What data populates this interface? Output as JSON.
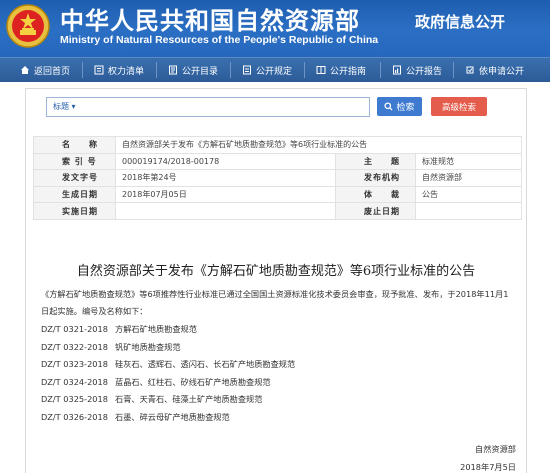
{
  "header": {
    "title": "中华人民共和国自然资源部",
    "subtitle": "Ministry of Natural Resources of the People's Republic of China",
    "section": "政府信息公开"
  },
  "nav": {
    "items": [
      {
        "label": "返回首页",
        "icon": "home-icon"
      },
      {
        "label": "权力清单",
        "icon": "list-icon"
      },
      {
        "label": "公开目录",
        "icon": "catalog-icon"
      },
      {
        "label": "公开规定",
        "icon": "rules-icon"
      },
      {
        "label": "公开指南",
        "icon": "guide-icon"
      },
      {
        "label": "公开报告",
        "icon": "report-icon"
      },
      {
        "label": "依申请公开",
        "icon": "apply-icon"
      }
    ]
  },
  "search": {
    "field_select": "标题 ▾",
    "search_label": "检索",
    "advanced_label": "高级检索"
  },
  "meta": {
    "name_label": "名　　称",
    "name_value": "自然资源部关于发布《方解石矿地质勘查规范》等6项行业标准的公告",
    "index_label": "索  引  号",
    "index_value": "000019174/2018-00178",
    "theme_label": "主　　题",
    "theme_value": "标准规范",
    "doc_no_label": "发文字号",
    "doc_no_value": "2018年第24号",
    "issuer_label": "发布机构",
    "issuer_value": "自然资源部",
    "created_label": "生成日期",
    "created_value": "2018年07月05日",
    "genre_label": "体　　裁",
    "genre_value": "公告",
    "effective_label": "实施日期",
    "effective_value": "",
    "abolish_label": "废止日期",
    "abolish_value": ""
  },
  "article": {
    "title": "自然资源部关于发布《方解石矿地质勘查规范》等6项行业标准的公告",
    "intro": "《方解石矿地质勘查规范》等6项推荐性行业标准已通过全国国土资源标准化技术委员会审查，现予批准、发布，于2018年11月1日起实施。编号及名称如下：",
    "standards": [
      {
        "code": "DZ/T 0321-2018",
        "name": "方解石矿地质勘查规范"
      },
      {
        "code": "DZ/T 0322-2018",
        "name": "钒矿地质勘查规范"
      },
      {
        "code": "DZ/T 0323-2018",
        "name": "硅灰石、透辉石、透闪石、长石矿产地质勘查规范"
      },
      {
        "code": "DZ/T 0324-2018",
        "name": "蓝晶石、红柱石、矽线石矿产地质勘查规范"
      },
      {
        "code": "DZ/T 0325-2018",
        "name": "石膏、天青石、硅藻土矿产地质勘查规范"
      },
      {
        "code": "DZ/T 0326-2018",
        "name": "石墨、碎云母矿产地质勘查规范"
      }
    ],
    "signature_org": "自然资源部",
    "signature_date": "2018年7月5日"
  },
  "colors": {
    "header_blue": "#2567bc",
    "nav_blue": "#2c5c98",
    "search_button": "#3d7ad0",
    "advanced_button": "#e35c4c"
  }
}
